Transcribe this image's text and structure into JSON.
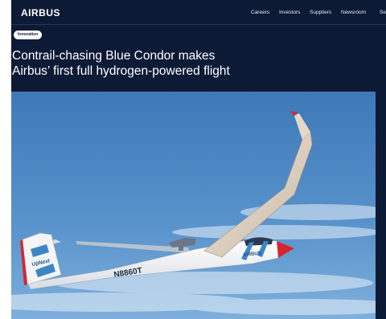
{
  "header": {
    "logo": "AIRBUS",
    "nav": [
      "Careers",
      "Investors",
      "Suppliers",
      "Newsroom",
      "Se"
    ]
  },
  "article": {
    "tag": "Innovation",
    "title_line1": "Contrail-chasing Blue Condor makes",
    "title_line2": "Airbus’ first full hydrogen-powered flight"
  },
  "image": {
    "registration": "N8860T",
    "fuselage_brand": "AIRBUS",
    "tail_text": "UpNext"
  },
  "colors": {
    "header_bg": "#0d1a36",
    "sky": "#4f89c6",
    "nose": "#d7262e",
    "accent_blue": "#3d86c5"
  }
}
